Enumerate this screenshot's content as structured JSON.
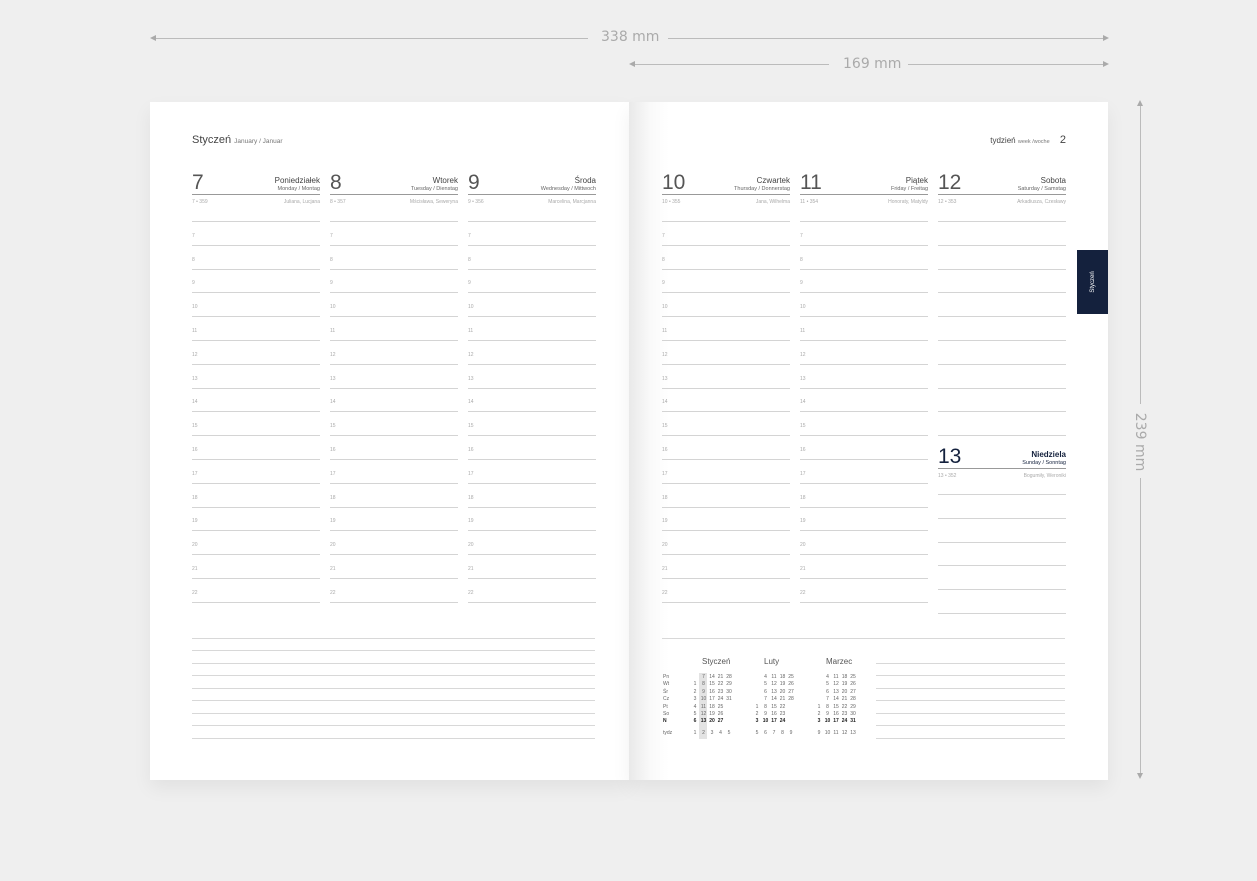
{
  "dimensions": {
    "width_total": "338 mm",
    "width_page": "169 mm",
    "height": "239 mm"
  },
  "header": {
    "month": "Styczeń",
    "month_sub": "January / Januar",
    "week_label": "tydzień",
    "week_sub": "week /woche",
    "week_num": "2"
  },
  "hours": [
    "7",
    "8",
    "9",
    "10",
    "11",
    "12",
    "13",
    "14",
    "15",
    "16",
    "17",
    "18",
    "19",
    "20",
    "21",
    "22"
  ],
  "days_left": [
    {
      "num": "7",
      "name": "Poniedziałek",
      "sub": "Monday / Montag",
      "count": "7 • 359",
      "names": "Juliana, Lucjana"
    },
    {
      "num": "8",
      "name": "Wtorek",
      "sub": "Tuesday / Dienstag",
      "count": "8 • 357",
      "names": "Mścisława, Seweryna"
    },
    {
      "num": "9",
      "name": "Środa",
      "sub": "Wednesday / Mittwoch",
      "count": "9 • 356",
      "names": "Marcelina, Marcjanna"
    }
  ],
  "days_right": [
    {
      "num": "10",
      "name": "Czwartek",
      "sub": "Thursday / Donnerstag",
      "count": "10 • 355",
      "names": "Jana, Wilhelma"
    },
    {
      "num": "11",
      "name": "Piątek",
      "sub": "Friday / Freitag",
      "count": "11 • 354",
      "names": "Honoraty, Matyldy"
    },
    {
      "num": "12",
      "name": "Sobota",
      "sub": "Saturday / Samstag",
      "count": "12 • 353",
      "names": "Arkadiusza, Czesławy"
    }
  ],
  "sunday": {
    "num": "13",
    "name": "Niedziela",
    "sub": "Sunday / Sonntag",
    "count": "13 • 352",
    "names": "Bogumiły, Weroniki"
  },
  "tab_label": "Styczeń",
  "mini_calendar": {
    "day_labels": [
      "Pn",
      "Wt",
      "Śr",
      "Cz",
      "Pt",
      "So",
      "N"
    ],
    "week_label": "tydz",
    "months": [
      {
        "name": "Styczeń",
        "rows": [
          [
            "",
            "7",
            "14",
            "21",
            "28"
          ],
          [
            "1",
            "8",
            "15",
            "22",
            "29"
          ],
          [
            "2",
            "9",
            "16",
            "23",
            "30"
          ],
          [
            "3",
            "10",
            "17",
            "24",
            "31"
          ],
          [
            "4",
            "11",
            "18",
            "25",
            ""
          ],
          [
            "5",
            "12",
            "19",
            "26",
            ""
          ],
          [
            "6",
            "13",
            "20",
            "27",
            ""
          ]
        ],
        "weeks": [
          "1",
          "2",
          "3",
          "4",
          "5"
        ]
      },
      {
        "name": "Luty",
        "rows": [
          [
            "",
            "4",
            "11",
            "18",
            "25"
          ],
          [
            "",
            "5",
            "12",
            "19",
            "26"
          ],
          [
            "",
            "6",
            "13",
            "20",
            "27"
          ],
          [
            "",
            "7",
            "14",
            "21",
            "28"
          ],
          [
            "1",
            "8",
            "15",
            "22",
            ""
          ],
          [
            "2",
            "9",
            "16",
            "23",
            ""
          ],
          [
            "3",
            "10",
            "17",
            "24",
            ""
          ]
        ],
        "weeks": [
          "5",
          "6",
          "7",
          "8",
          "9"
        ]
      },
      {
        "name": "Marzec",
        "rows": [
          [
            "",
            "4",
            "11",
            "18",
            "25"
          ],
          [
            "",
            "5",
            "12",
            "19",
            "26"
          ],
          [
            "",
            "6",
            "13",
            "20",
            "27"
          ],
          [
            "",
            "7",
            "14",
            "21",
            "28"
          ],
          [
            "1",
            "8",
            "15",
            "22",
            "29"
          ],
          [
            "2",
            "9",
            "16",
            "23",
            "30"
          ],
          [
            "3",
            "10",
            "17",
            "24",
            "31"
          ]
        ],
        "weeks": [
          "9",
          "10",
          "11",
          "12",
          "13"
        ]
      }
    ]
  }
}
